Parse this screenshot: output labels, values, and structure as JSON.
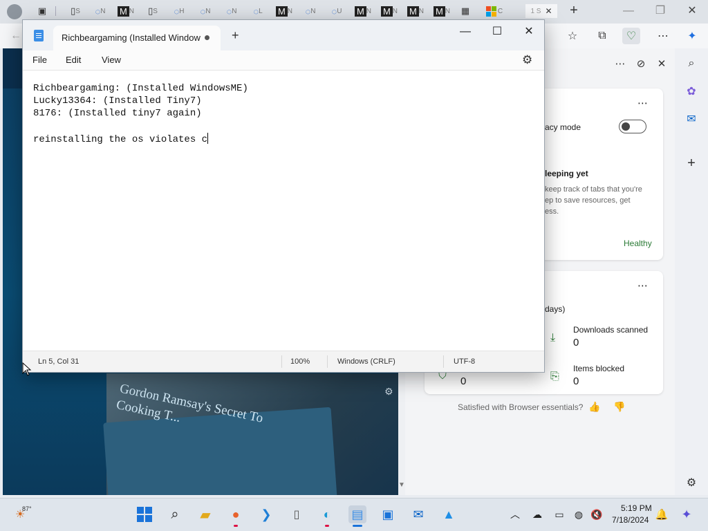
{
  "browser": {
    "tab_labels": [
      "S",
      "N",
      "S",
      "H",
      "N",
      "L",
      "N",
      "U",
      "N",
      "N",
      "N",
      "N",
      "C",
      "1 S"
    ],
    "new_tab_symbol": "+",
    "window_controls": {
      "minimize": "—",
      "maximize": "❐",
      "close": "✕"
    }
  },
  "side_panel": {
    "privacy_mode_label": "acy mode",
    "sleeping_heading": "leeping yet",
    "sleeping_desc_1": "keep track of tabs that you're",
    "sleeping_desc_2": "ep to save resources, get",
    "sleeping_desc_3": "ess.",
    "status": "Healthy",
    "days_label": "days)",
    "downloads_scanned_label": "Downloads scanned",
    "downloads_scanned_value": "0",
    "items_blocked_label": "Items blocked",
    "items_blocked_value": "0",
    "shield_value": "0",
    "feedback": "Satisfied with Browser essentials?"
  },
  "web_page": {
    "book_title": "Gordon Ramsay's Secret To Cooking T..."
  },
  "notepad": {
    "tab_title": "Richbeargaming (Installed Window",
    "add_tab": "+",
    "menu": {
      "file": "File",
      "edit": "Edit",
      "view": "View"
    },
    "lines": [
      "Richbeargaming: (Installed WindowsME)",
      "Lucky13364: (Installed Tiny7)",
      "8176: (Installed tiny7 again)",
      "",
      "reinstalling the os violates c"
    ],
    "status": {
      "position": "Ln 5, Col 31",
      "zoom": "100%",
      "line_ending": "Windows (CRLF)",
      "encoding": "UTF-8"
    },
    "window_controls": {
      "minimize": "—",
      "maximize": "☐",
      "close": "✕"
    }
  },
  "taskbar": {
    "weather_temp": "87°",
    "time": "5:19 PM",
    "date": "7/18/2024"
  }
}
